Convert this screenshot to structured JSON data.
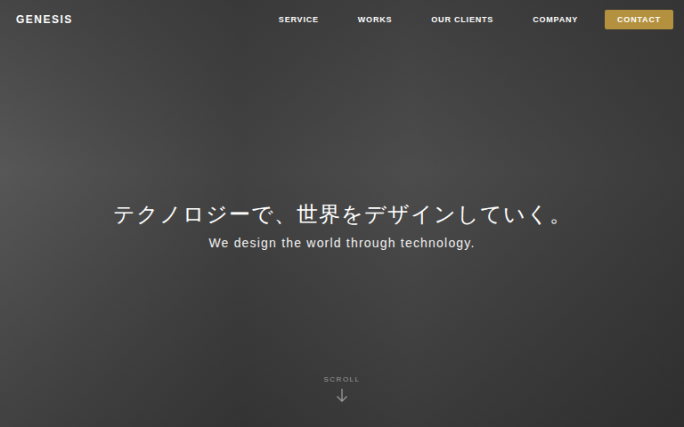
{
  "header": {
    "logo": "GENESIS",
    "nav": [
      "SERVICE",
      "WORKS",
      "OUR CLIENTS",
      "COMPANY"
    ],
    "contact": "CONTACT"
  },
  "hero": {
    "title": "テクノロジーで、世界をデザインしていく。",
    "subtitle": "We design the world through technology.",
    "scroll": "SCROLL"
  }
}
